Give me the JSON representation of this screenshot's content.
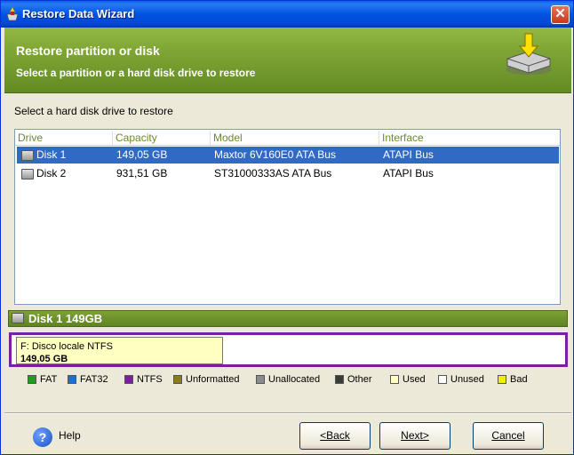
{
  "window": {
    "title": "Restore Data Wizard",
    "close_label": "✕"
  },
  "banner": {
    "title": "Restore partition or disk",
    "subtitle": "Select a partition or a hard disk drive to restore"
  },
  "prompt": "Select a hard disk drive to restore",
  "disk_list": {
    "columns": [
      "Drive",
      "Capacity",
      "Model",
      "Interface"
    ],
    "rows": [
      {
        "drive": "Disk 1",
        "capacity": "149,05 GB",
        "model": "Maxtor 6V160E0 ATA Bus",
        "interface": "ATAPI Bus",
        "selected": true
      },
      {
        "drive": "Disk 2",
        "capacity": "931,51 GB",
        "model": "ST31000333AS ATA Bus",
        "interface": "ATAPI Bus",
        "selected": false
      }
    ]
  },
  "disk_bar": {
    "label": "Disk 1  149GB"
  },
  "partition": {
    "line1": "F:  Disco locale  NTFS",
    "line2": "149,05 GB",
    "color": "#ffffc2",
    "border_color": "#7b1fa2"
  },
  "legend": [
    {
      "label": "FAT",
      "color": "#1e9e1e"
    },
    {
      "label": "FAT32",
      "color": "#1e6fd0"
    },
    {
      "label": "NTFS",
      "color": "#7b1fa2"
    },
    {
      "label": "Unformatted",
      "color": "#8a7a1e"
    },
    {
      "label": "Unallocated",
      "color": "#8c8c8c"
    },
    {
      "label": "Other",
      "color": "#3a3a3a"
    },
    {
      "label": "Used",
      "color": "#ffffc2"
    },
    {
      "label": "Unused",
      "color": "#ffffff"
    },
    {
      "label": "Bad",
      "color": "#f0f000"
    }
  ],
  "footer": {
    "help_label": "Help",
    "back_label": "<Back",
    "next_label": "Next>",
    "cancel_label": "Cancel"
  },
  "colors": {
    "title_bar": "#0054e3",
    "banner": "#7fa634",
    "selection": "#316ac5"
  }
}
